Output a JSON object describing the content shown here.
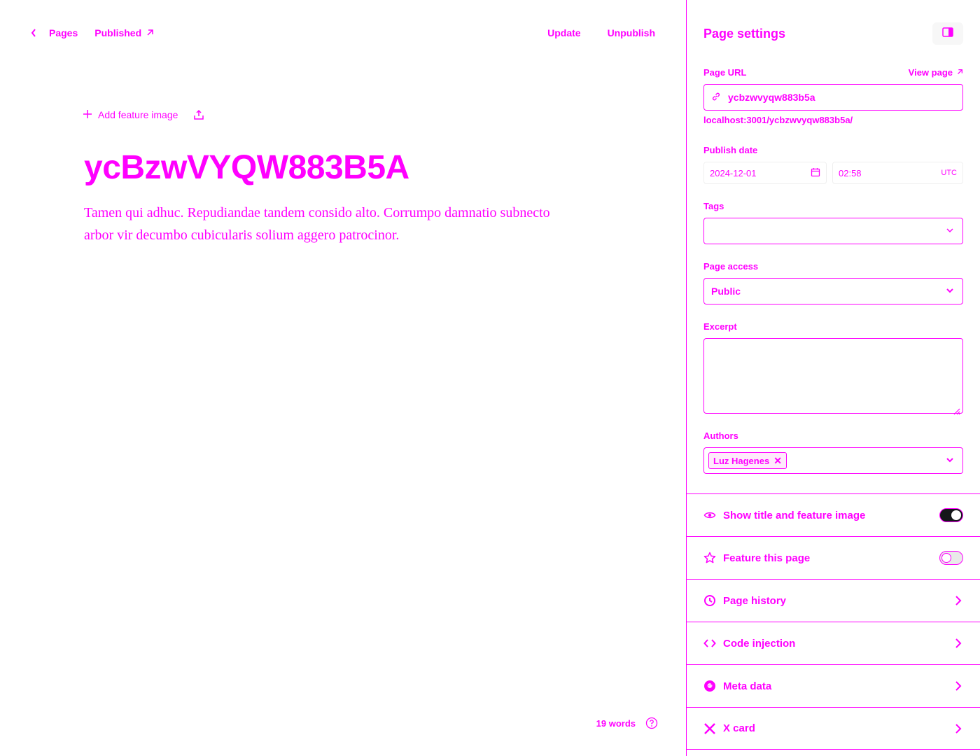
{
  "nav": {
    "back_label": "Pages",
    "status_label": "Published"
  },
  "actions": {
    "update_label": "Update",
    "unpublish_label": "Unpublish"
  },
  "editor": {
    "add_feature_label": "Add feature image",
    "title": "ycBzwVYQW883B5A",
    "excerpt": "Tamen qui adhuc. Repudiandae tandem consido alto. Corrumpo damnatio subnecto arbor vir decumbo cubicularis solium aggero patrocinor.",
    "word_count": "19 words"
  },
  "settings": {
    "title": "Page settings",
    "url": {
      "label": "Page URL",
      "view_page_label": "View page",
      "slug": "ycbzwvyqw883b5a",
      "full_url": "localhost:3001/ycbzwvyqw883b5a/"
    },
    "publish": {
      "label": "Publish date",
      "date": "2024-12-01",
      "time": "02:58",
      "timezone": "UTC"
    },
    "tags": {
      "label": "Tags",
      "value": ""
    },
    "access": {
      "label": "Page access",
      "value": "Public"
    },
    "excerpt": {
      "label": "Excerpt",
      "value": ""
    },
    "authors": {
      "label": "Authors",
      "items": [
        "Luz Hagenes"
      ]
    },
    "rows": [
      {
        "label": "Show title and feature image",
        "icon": "eye-icon",
        "control": "toggle",
        "on": true
      },
      {
        "label": "Feature this page",
        "icon": "star-icon",
        "control": "toggle",
        "on": false
      },
      {
        "label": "Page history",
        "icon": "history-icon",
        "control": "arrow"
      },
      {
        "label": "Code injection",
        "icon": "code-icon",
        "control": "arrow"
      },
      {
        "label": "Meta data",
        "icon": "google-icon",
        "control": "arrow"
      },
      {
        "label": "X card",
        "icon": "x-logo-icon",
        "control": "arrow"
      }
    ]
  },
  "colors": {
    "accent": "#ff00ff",
    "toggle_on": "#15171a"
  }
}
